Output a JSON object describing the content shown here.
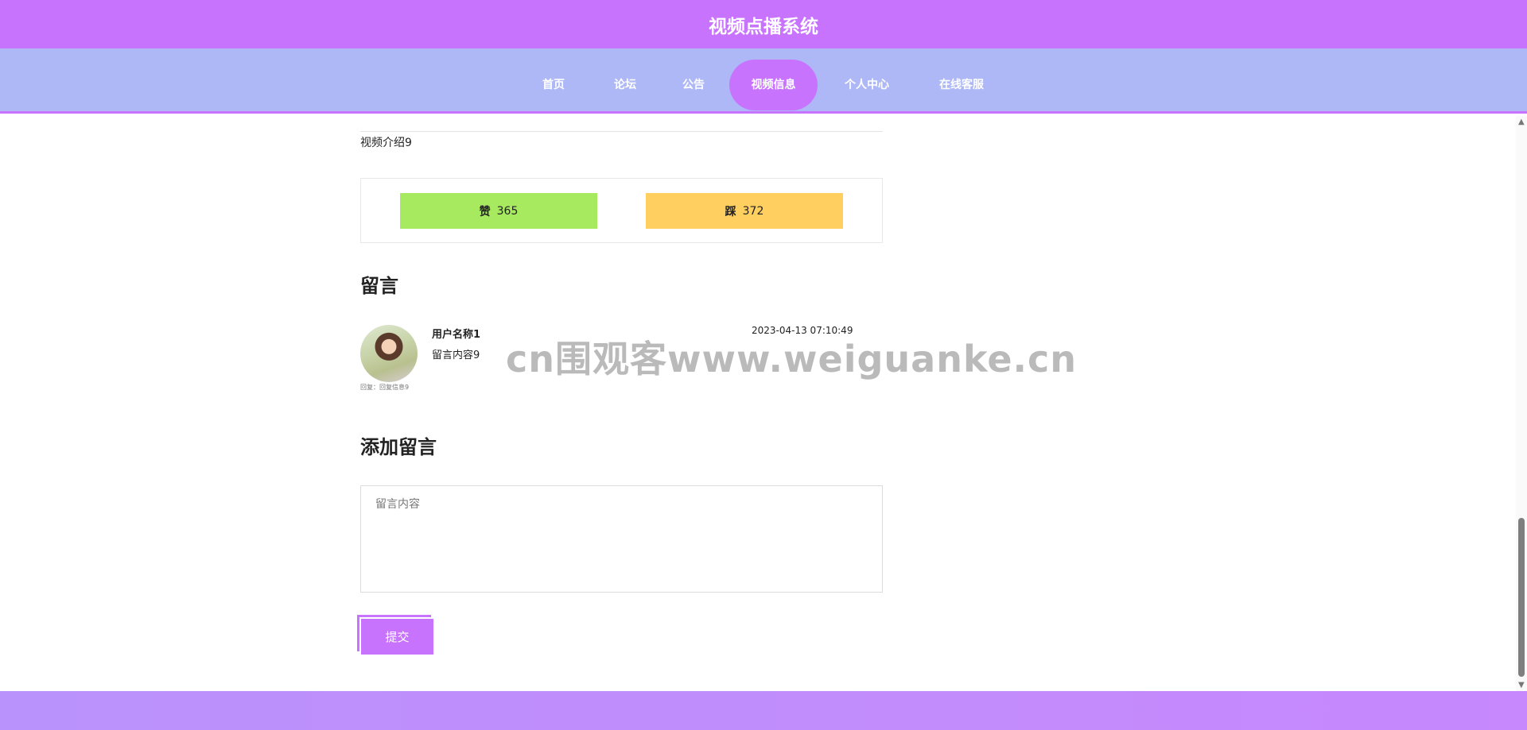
{
  "header": {
    "title": "视频点播系统"
  },
  "nav": {
    "items": [
      {
        "label": "首页"
      },
      {
        "label": "论坛"
      },
      {
        "label": "公告"
      },
      {
        "label": "视频信息"
      },
      {
        "label": "个人中心"
      },
      {
        "label": "在线客服"
      }
    ],
    "active": "视频信息"
  },
  "video": {
    "intro": "视频介绍9",
    "like": {
      "label": "赞",
      "count": "365"
    },
    "dislike": {
      "label": "踩",
      "count": "372"
    }
  },
  "comments": {
    "title": "留言",
    "items": [
      {
        "user": "用户名称1",
        "time": "2023-04-13 07:10:49",
        "content": "留言内容9",
        "reply": "回复：回复信息9"
      }
    ]
  },
  "add_comment": {
    "title": "添加留言",
    "placeholder": "留言内容",
    "submit_label": "提交"
  },
  "watermark": "cn围观客www.weiguanke.cn",
  "colors": {
    "primary": "#c873fe",
    "nav_bg": "#aeb8f6",
    "like": "#a8ea5f",
    "dislike": "#ffcf60"
  }
}
